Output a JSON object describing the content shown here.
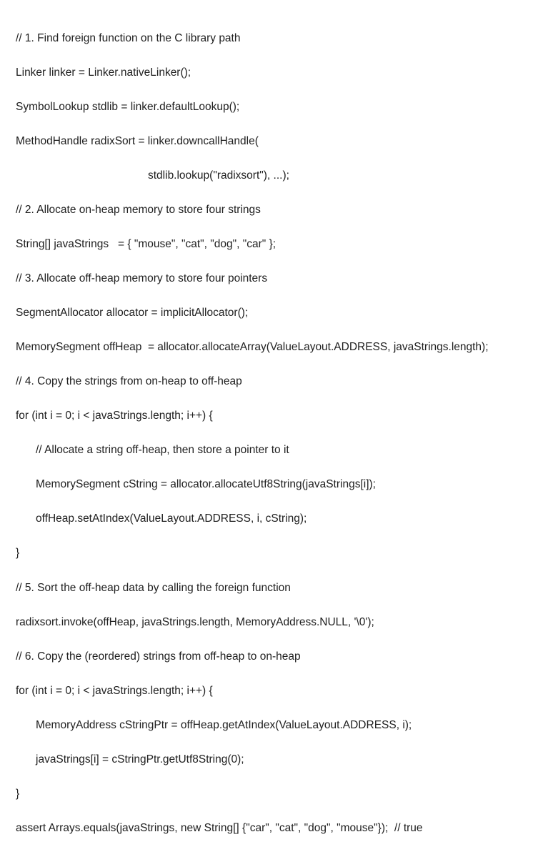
{
  "code": {
    "l01": "// 1. Find foreign function on the C library path",
    "l02": "Linker linker = Linker.nativeLinker();",
    "l03": "SymbolLookup stdlib = linker.defaultLookup();",
    "l04": "MethodHandle radixSort = linker.downcallHandle(",
    "l05": "stdlib.lookup(\"radixsort\"), ...);",
    "l06": "// 2. Allocate on-heap memory to store four strings",
    "l07": "String[] javaStrings   = { \"mouse\", \"cat\", \"dog\", \"car\" };",
    "l08": "// 3. Allocate off-heap memory to store four pointers",
    "l09": "SegmentAllocator allocator = implicitAllocator();",
    "l10": "MemorySegment offHeap  = allocator.allocateArray(ValueLayout.ADDRESS, javaStrings.length);",
    "l11": "// 4. Copy the strings from on-heap to off-heap",
    "l12": "for (int i = 0; i < javaStrings.length; i++) {",
    "l13": "// Allocate a string off-heap, then store a pointer to it",
    "l14": "MemorySegment cString = allocator.allocateUtf8String(javaStrings[i]);",
    "l15": "offHeap.setAtIndex(ValueLayout.ADDRESS, i, cString);",
    "l16": "}",
    "l17": "// 5. Sort the off-heap data by calling the foreign function",
    "l18": "radixsort.invoke(offHeap, javaStrings.length, MemoryAddress.NULL, '\\0');",
    "l19": "// 6. Copy the (reordered) strings from off-heap to on-heap",
    "l20": "for (int i = 0; i < javaStrings.length; i++) {",
    "l21": "MemoryAddress cStringPtr = offHeap.getAtIndex(ValueLayout.ADDRESS, i);",
    "l22": "javaStrings[i] = cStringPtr.getUtf8String(0);",
    "l23": "}",
    "l24": "assert Arrays.equals(javaStrings, new String[] {\"car\", \"cat\", \"dog\", \"mouse\"});  // true"
  }
}
